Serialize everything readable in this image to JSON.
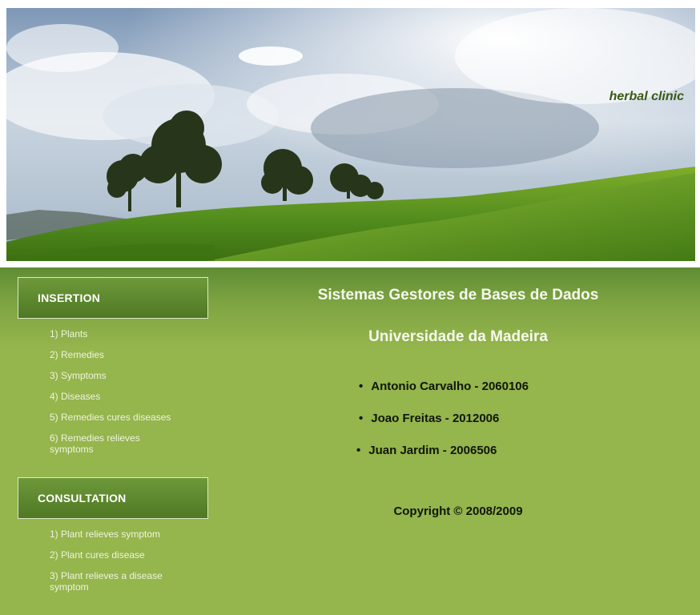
{
  "banner": {
    "brand": "herbal clinic"
  },
  "sidebar": {
    "insertion": {
      "title": "INSERTION",
      "items": [
        "1) Plants",
        "2) Remedies",
        "3) Symptoms",
        "4) Diseases",
        "5) Remedies cures diseases",
        "6) Remedies relieves symptoms"
      ]
    },
    "consultation": {
      "title": "CONSULTATION",
      "items": [
        "1) Plant relieves symptom",
        "2) Plant cures disease",
        "3) Plant relieves a disease symptom"
      ]
    }
  },
  "content": {
    "title": "Sistemas Gestores de Bases de Dados",
    "subtitle": "Universidade da Madeira",
    "people": [
      "Antonio Carvalho - 2060106",
      "Joao Freitas - 2012006",
      "Juan Jardim - 2006506"
    ],
    "copyright": "Copyright © 2008/2009"
  },
  "colors": {
    "background_green": "#95b54d",
    "box_green": "#5a832c",
    "brand_text": "#3b5a14"
  }
}
